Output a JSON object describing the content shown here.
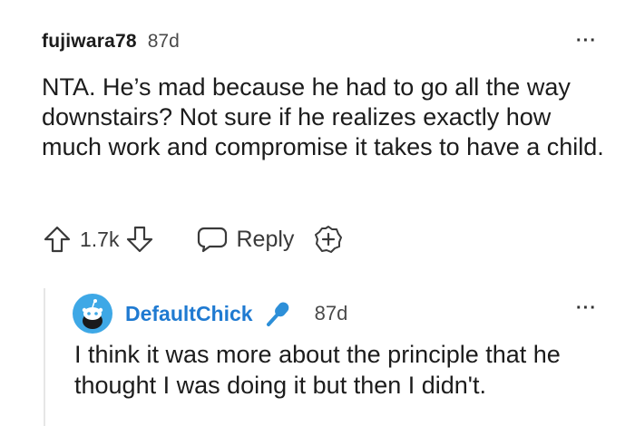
{
  "comment": {
    "author": "fujiwara78",
    "age": "87d",
    "body": "NTA. He’s mad because he had to go all the way downstairs? Not sure if he realizes exactly how much work and compromise it takes to have a child.",
    "score": "1.7k",
    "reply_label": "Reply",
    "more_label": "···"
  },
  "reply": {
    "author": "DefaultChick",
    "age": "87d",
    "body": "I think it was more about the principle that he thought I was doing it but then I didn't.",
    "more_label": "···",
    "author_color": "#1f7ad1",
    "badge_icon": "microphone-icon"
  },
  "colors": {
    "avatar_bg": "#3ea8e6",
    "badge": "#2d8fd8",
    "text": "#1c1c1c",
    "muted": "#4a4a4a"
  }
}
